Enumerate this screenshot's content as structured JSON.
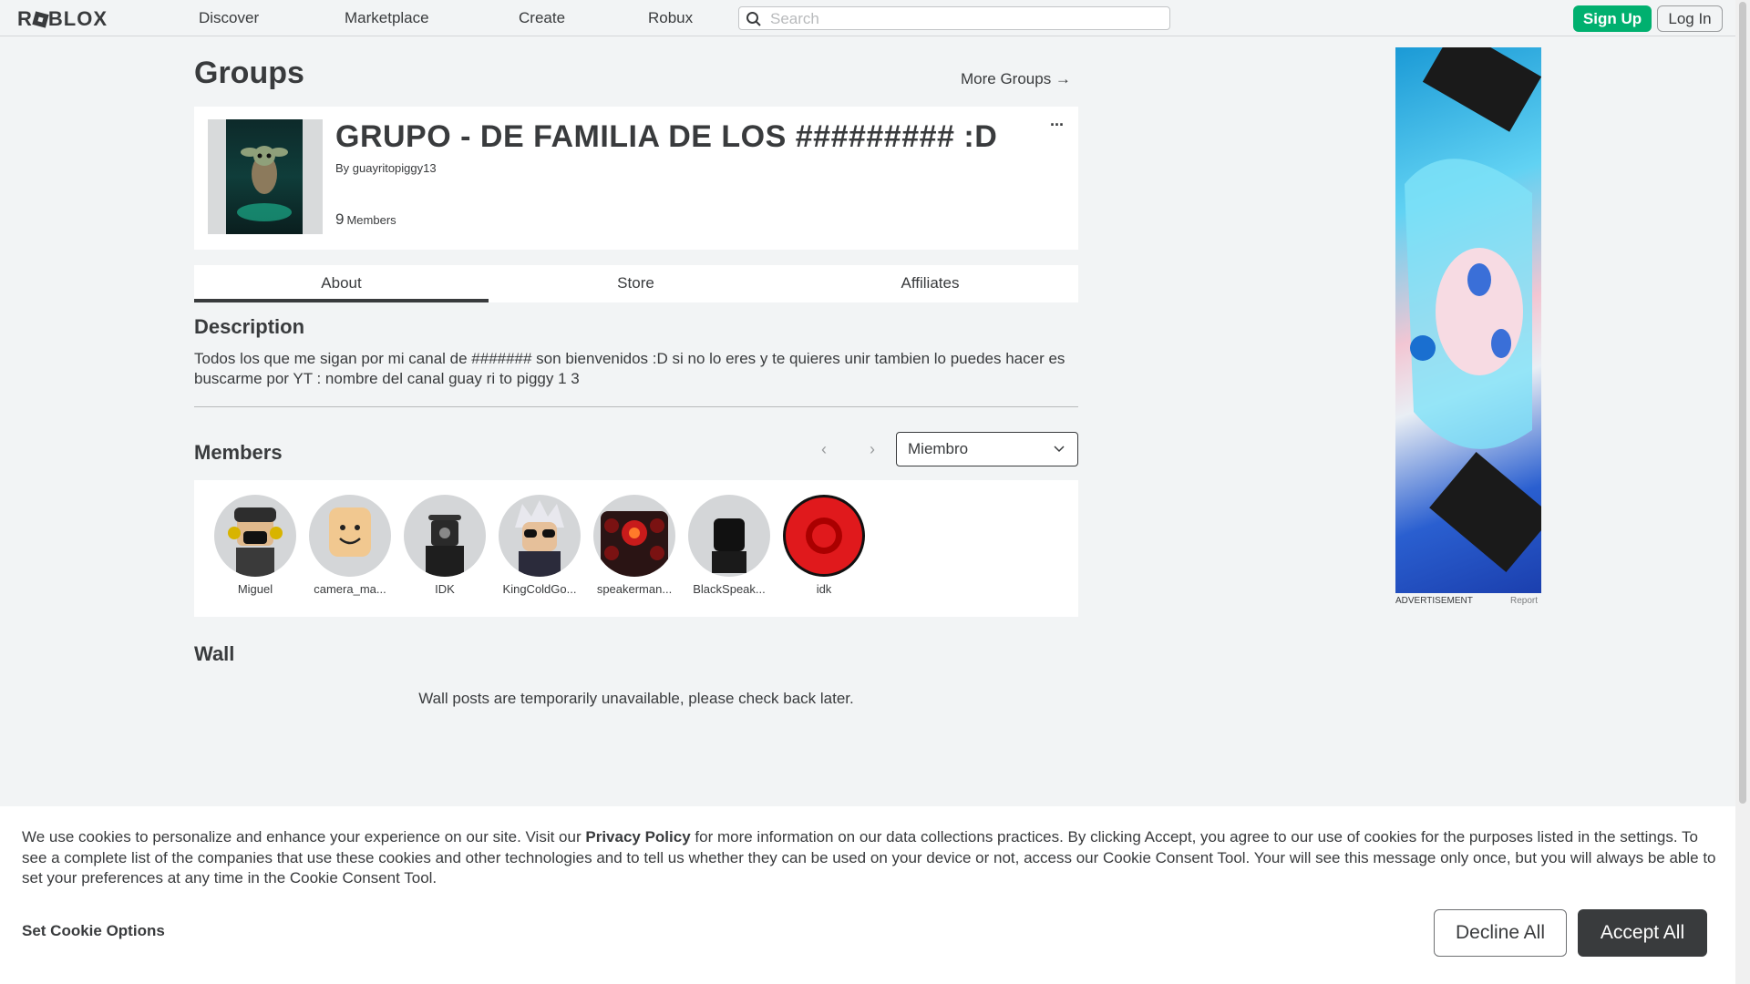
{
  "nav": {
    "logo": "ROBLOX",
    "links": [
      "Discover",
      "Marketplace",
      "Create",
      "Robux"
    ],
    "search_placeholder": "Search",
    "signup_label": "Sign Up",
    "login_label": "Log In"
  },
  "page": {
    "title": "Groups",
    "more_groups": "More Groups →"
  },
  "group": {
    "name": "GRUPO - DE FAMILIA DE LOS ######### :D",
    "by_prefix": "By",
    "owner": "guayritopiggy13",
    "member_count": "9",
    "members_label": "Members",
    "more_icon": "···"
  },
  "tabs": [
    "About",
    "Store",
    "Affiliates"
  ],
  "active_tab": "About",
  "description": {
    "heading": "Description",
    "text": "Todos los que me sigan por mi canal de ####### son bienvenidos :D si no lo eres y te quieres unir tambien lo puedes hacer es buscarme por YT : nombre del canal guay ri to piggy 1 3"
  },
  "members": {
    "heading": "Members",
    "role_selected": "Miembro",
    "list": [
      {
        "name": "Miguel",
        "color": "#c9cbcd"
      },
      {
        "name": "camera_ma...",
        "color": "#e6c79b"
      },
      {
        "name": "IDK",
        "color": "#cfd1d3"
      },
      {
        "name": "KingColdGo...",
        "color": "#c6c8ca"
      },
      {
        "name": "speakerman...",
        "color": "#d0d2d4"
      },
      {
        "name": "BlackSpeak...",
        "color": "#cdcfd1"
      },
      {
        "name": "idk",
        "color": "#e0191c"
      }
    ]
  },
  "wall": {
    "heading": "Wall",
    "message": "Wall posts are temporarily unavailable, please check back later."
  },
  "ad": {
    "label": "ADVERTISEMENT",
    "report": "Report"
  },
  "cookie": {
    "text_before": "We use cookies to personalize and enhance your experience on our site. Visit our ",
    "privacy_link": "Privacy Policy",
    "text_after": " for more information on our data collections practices. By clicking Accept, you agree to our use of cookies for the purposes listed in the settings. To see a complete list of the companies that use these cookies and other technologies and to tell us whether they can be used on your device or not, access our Cookie Consent Tool. Your will see this message only once, but you will always be able to set your preferences at any time in the Cookie Consent Tool.",
    "options_label": "Set Cookie Options",
    "decline_label": "Decline All",
    "accept_label": "Accept All"
  }
}
